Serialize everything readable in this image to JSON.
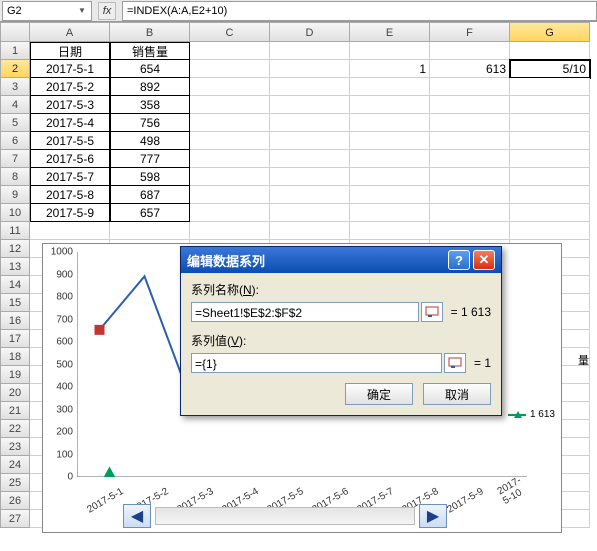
{
  "formula_bar": {
    "name_box": "G2",
    "formula": "=INDEX(A:A,E2+10)"
  },
  "columns": [
    "",
    "A",
    "B",
    "C",
    "D",
    "E",
    "F",
    "G"
  ],
  "rows_visible": 27,
  "active_cell": "G2",
  "table": {
    "headers": {
      "A": "日期",
      "B": "销售量"
    },
    "data": [
      {
        "row": 1,
        "A": "日期",
        "B": "销售量"
      },
      {
        "row": 2,
        "A": "2017-5-1",
        "B": "654",
        "E": "1",
        "F": "613",
        "G": "5/10"
      },
      {
        "row": 3,
        "A": "2017-5-2",
        "B": "892"
      },
      {
        "row": 4,
        "A": "2017-5-3",
        "B": "358"
      },
      {
        "row": 5,
        "A": "2017-5-4",
        "B": "756"
      },
      {
        "row": 6,
        "A": "2017-5-5",
        "B": "498"
      },
      {
        "row": 7,
        "A": "2017-5-6",
        "B": "777"
      },
      {
        "row": 8,
        "A": "2017-5-7",
        "B": "598"
      },
      {
        "row": 9,
        "A": "2017-5-8",
        "B": "687"
      },
      {
        "row": 10,
        "A": "2017-5-9",
        "B": "657"
      }
    ]
  },
  "chart_data": {
    "type": "line",
    "series": [
      {
        "name": "销售量",
        "color": "#2a5db0",
        "values": [
          654,
          892,
          358
        ],
        "marker": "square",
        "marker_color": "#c23531"
      },
      {
        "name": "1 613",
        "color": "#009d57",
        "values": [
          null,
          null,
          null,
          null,
          null,
          null,
          null,
          null,
          null,
          null
        ],
        "marker": "triangle",
        "highlight_index": 0,
        "highlight_value": 20
      }
    ],
    "categories": [
      "2017-5-1",
      "2017-5-2",
      "2017-5-3",
      "2017-5-4",
      "2017-5-5",
      "2017-5-6",
      "2017-5-7",
      "2017-5-8",
      "2017-5-9",
      "2017-5-10"
    ],
    "ylim": [
      0,
      1000
    ],
    "ytick": 100,
    "side_label": "量",
    "legend_label": "1 613"
  },
  "dialog": {
    "title": "编辑数据系列",
    "field1_label_pre": "系列名称(",
    "field1_label_u": "N",
    "field1_label_post": "):",
    "field1_value": "=Sheet1!$E$2:$F$2",
    "field1_result": "= 1 613",
    "field2_label_pre": "系列值(",
    "field2_label_u": "V",
    "field2_label_post": "):",
    "field2_value": "={1}",
    "field2_result": "= 1",
    "ok": "确定",
    "cancel": "取消"
  }
}
